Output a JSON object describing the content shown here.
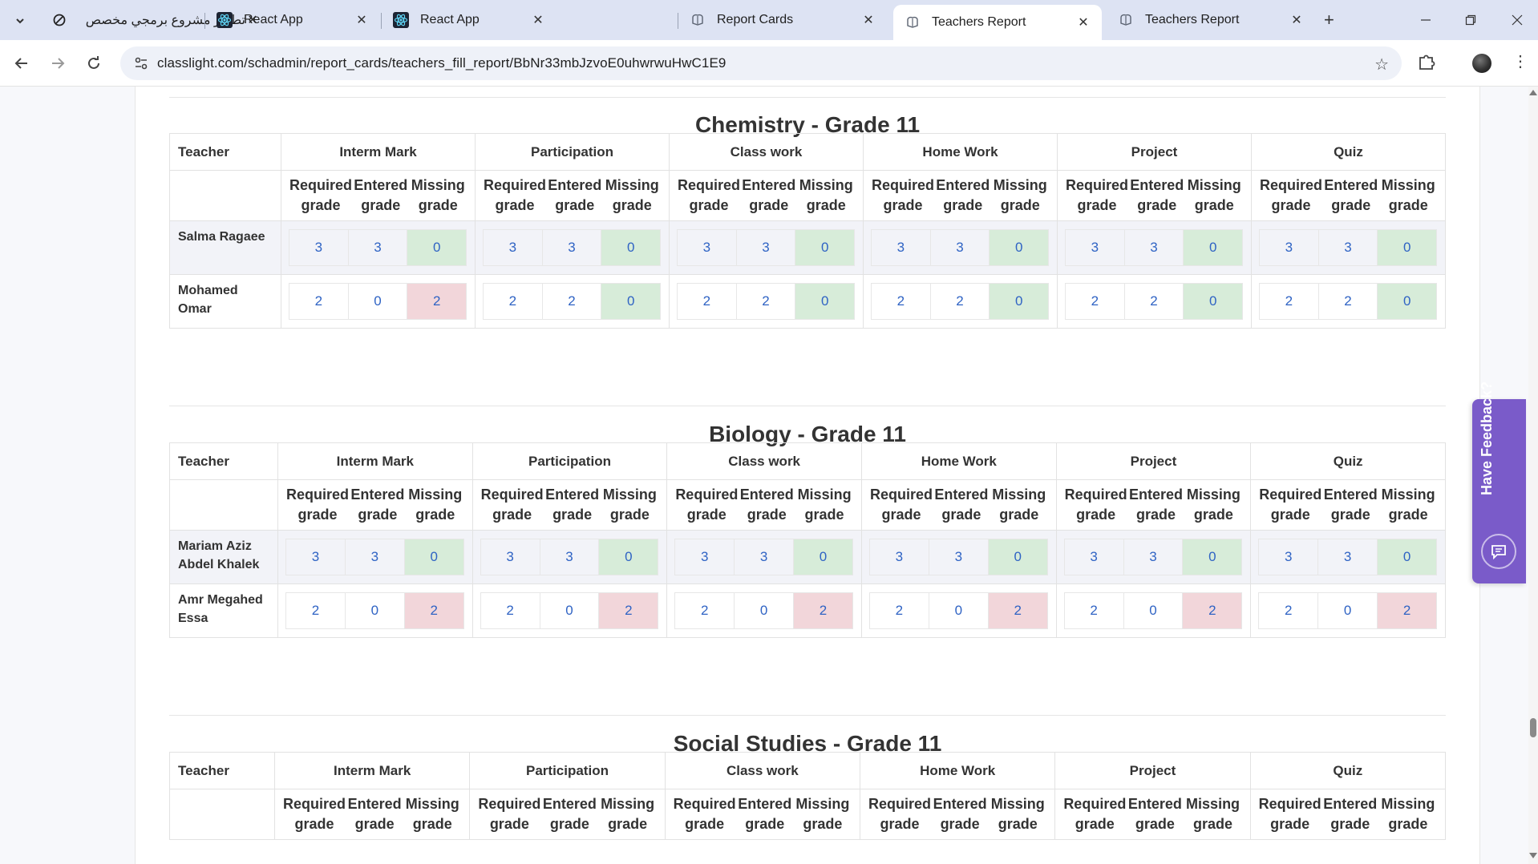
{
  "browser": {
    "tabs": [
      {
        "label": "تطوير مشروع برمجي مخصص",
        "icon": "openai-icon",
        "active": false
      },
      {
        "label": "React App",
        "icon": "react-icon",
        "active": false
      },
      {
        "label": "React App",
        "icon": "react-icon",
        "active": false
      },
      {
        "label": "Report Cards",
        "icon": "site-icon",
        "active": false
      },
      {
        "label": "Teachers Report",
        "icon": "site-icon",
        "active": true
      },
      {
        "label": "Teachers Report",
        "icon": "site-icon",
        "active": false
      }
    ],
    "url": "classlight.com/schadmin/report_cards/teachers_fill_report/BbNr33mbJzvoE0uhwrwuHwC1E9"
  },
  "report": {
    "teacher_header": "Teacher",
    "columns": [
      "Interm Mark",
      "Participation",
      "Class work",
      "Home Work",
      "Project",
      "Quiz"
    ],
    "sub_columns": [
      "Required grade",
      "Entered grade",
      "Missing grade"
    ],
    "sections": [
      {
        "title": "Chemistry - Grade 11",
        "rows": [
          {
            "teacher": "Salma Ragaee",
            "values": [
              [
                "3",
                "3",
                "0"
              ],
              [
                "3",
                "3",
                "0"
              ],
              [
                "3",
                "3",
                "0"
              ],
              [
                "3",
                "3",
                "0"
              ],
              [
                "3",
                "3",
                "0"
              ],
              [
                "3",
                "3",
                "0"
              ]
            ]
          },
          {
            "teacher": "Mohamed Omar",
            "values": [
              [
                "2",
                "0",
                "2"
              ],
              [
                "2",
                "2",
                "0"
              ],
              [
                "2",
                "2",
                "0"
              ],
              [
                "2",
                "2",
                "0"
              ],
              [
                "2",
                "2",
                "0"
              ],
              [
                "2",
                "2",
                "0"
              ]
            ]
          }
        ]
      },
      {
        "title": "Biology - Grade 11",
        "rows": [
          {
            "teacher": "Mariam Aziz Abdel Khalek",
            "values": [
              [
                "3",
                "3",
                "0"
              ],
              [
                "3",
                "3",
                "0"
              ],
              [
                "3",
                "3",
                "0"
              ],
              [
                "3",
                "3",
                "0"
              ],
              [
                "3",
                "3",
                "0"
              ],
              [
                "3",
                "3",
                "0"
              ]
            ]
          },
          {
            "teacher": "Amr Megahed Essa",
            "values": [
              [
                "2",
                "0",
                "2"
              ],
              [
                "2",
                "0",
                "2"
              ],
              [
                "2",
                "0",
                "2"
              ],
              [
                "2",
                "0",
                "2"
              ],
              [
                "2",
                "0",
                "2"
              ],
              [
                "2",
                "0",
                "2"
              ]
            ]
          }
        ]
      },
      {
        "title": "Social Studies - Grade 11",
        "rows": []
      }
    ]
  },
  "feedback": {
    "label": "Have Feedback?"
  },
  "colors": {
    "ok": "#d7ecd9",
    "missing": "#f2d6da",
    "value_text": "#2f63c4",
    "feedback_bg": "#7a5bc9"
  }
}
